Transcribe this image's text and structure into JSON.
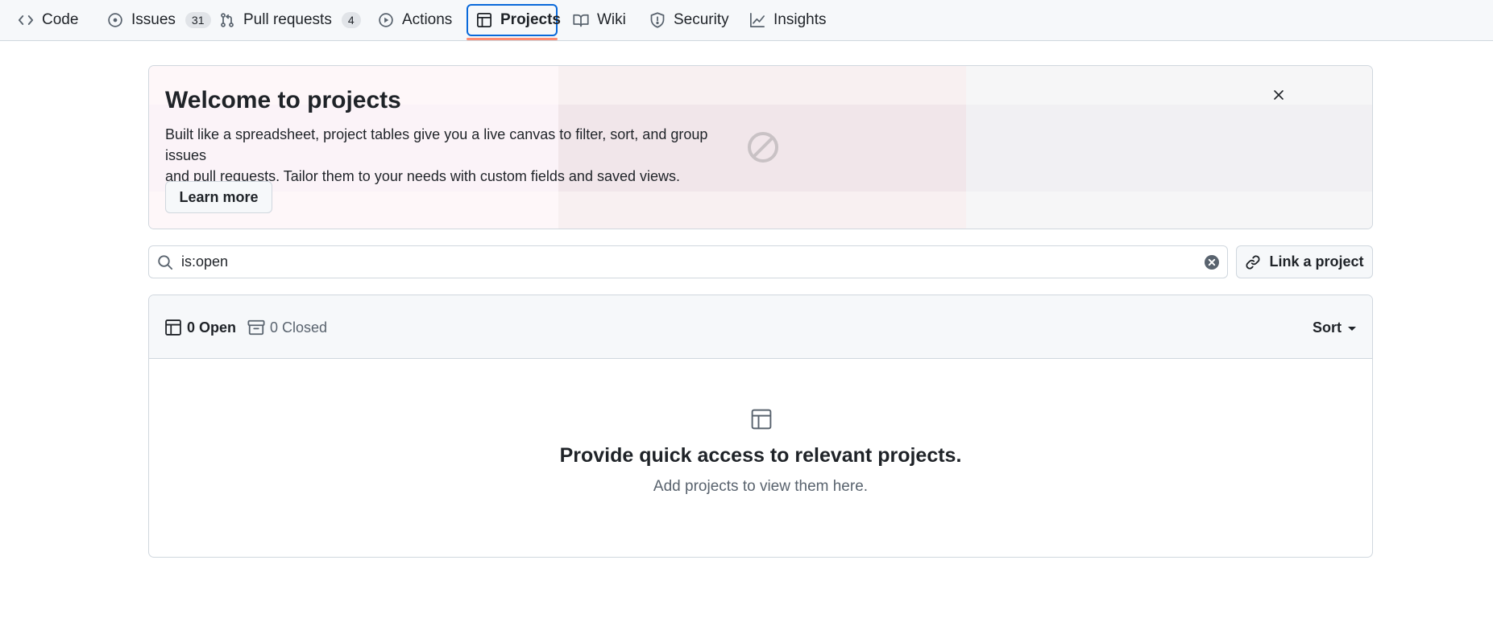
{
  "repo_nav": {
    "items": [
      {
        "label": "Code",
        "icon": "code-icon"
      },
      {
        "label": "Issues",
        "icon": "issue-opened-icon",
        "count": "31"
      },
      {
        "label": "Pull requests",
        "icon": "git-pull-request-icon",
        "count": "4"
      },
      {
        "label": "Actions",
        "icon": "play-icon"
      },
      {
        "label": "Projects",
        "icon": "table-icon",
        "selected": true
      },
      {
        "label": "Wiki",
        "icon": "book-icon"
      },
      {
        "label": "Security",
        "icon": "shield-icon"
      },
      {
        "label": "Insights",
        "icon": "graph-icon"
      }
    ]
  },
  "banner": {
    "title": "Welcome to projects",
    "description_line1": "Built like a spreadsheet, project tables give you a live canvas to filter, sort, and group issues",
    "description_line2": "and pull requests. Tailor them to your needs with custom fields and saved views.",
    "learn_more_label": "Learn more",
    "close_icon": "x-icon",
    "image_icon": "image-unavailable-icon"
  },
  "search": {
    "value": "is:open",
    "icon": "search-icon",
    "clear_icon": "x-circle-fill-icon"
  },
  "link_project": {
    "label": "Link a project",
    "icon": "link-icon"
  },
  "list": {
    "open_label": "0 Open",
    "closed_label": "0 Closed",
    "sort_label": "Sort",
    "blank_title": "Provide quick access to relevant projects.",
    "blank_subtitle": "Add projects to view them here."
  },
  "colors": {
    "accent": "#0969da",
    "selected_underline": "#fd8c73",
    "muted_text": "#59636e",
    "border": "#d0d7de"
  }
}
